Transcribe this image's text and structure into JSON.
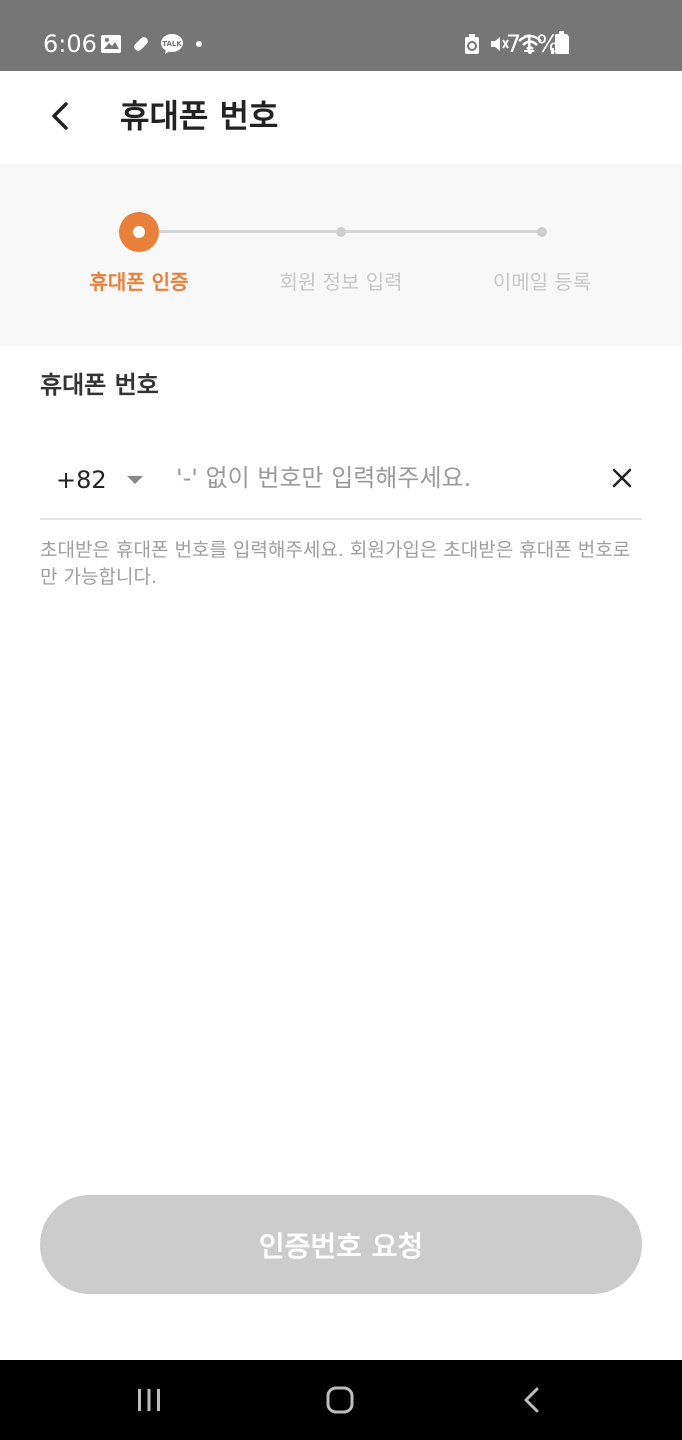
{
  "status_bar": {
    "time": "6:06",
    "battery_percent": "71%",
    "left_icons": [
      "image-icon",
      "pill-icon",
      "kakaotalk-icon",
      "dot-icon"
    ],
    "right_icons": [
      "recycle-icon",
      "mute-icon",
      "wifi-icon",
      "signal-icon",
      "battery-icon"
    ],
    "talk_badge": "TALK"
  },
  "header": {
    "title": "휴대폰 번호",
    "back_icon": "chevron-left-icon"
  },
  "stepper": {
    "steps": [
      {
        "label": "휴대폰 인증",
        "state": "active"
      },
      {
        "label": "회원 정보 입력",
        "state": "inactive"
      },
      {
        "label": "이메일 등록",
        "state": "inactive"
      }
    ],
    "active_color": "#e8803c",
    "inactive_color": "#c8c8c8"
  },
  "phone": {
    "section_label": "휴대폰 번호",
    "country_code": "+82",
    "placeholder": "'-' 없이 번호만 입력해주세요.",
    "value": "",
    "helper_text": "초대받은 휴대폰 번호를 입력해주세요. 회원가입은 초대받은 휴대폰 번호로만 가능합니다."
  },
  "actions": {
    "request_label": "인증번호 요청",
    "request_enabled": false
  },
  "nav_bar": {
    "buttons": [
      "recents-icon",
      "home-icon",
      "back-icon"
    ]
  }
}
